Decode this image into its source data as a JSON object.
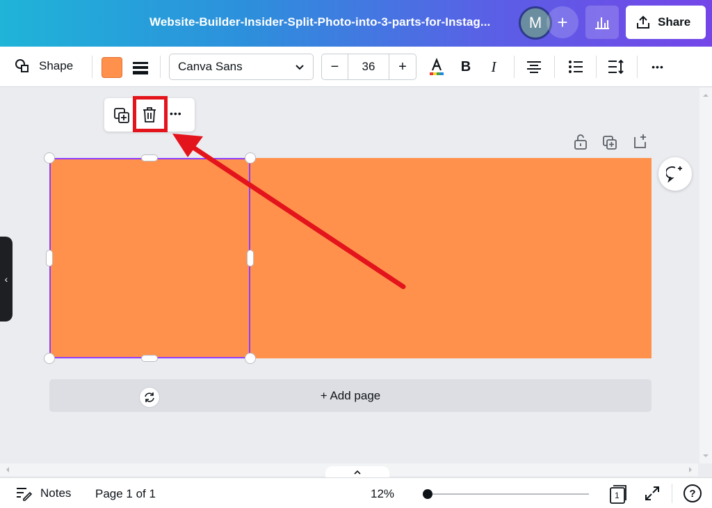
{
  "header": {
    "doc_title": "Website-Builder-Insider-Split-Photo-into-3-parts-for-Instag...",
    "avatar_initial": "M",
    "add_collab": "+",
    "share_label": "Share"
  },
  "toolbar": {
    "shape_label": "Shape",
    "fill_color": "#ff914d",
    "font_family": "Canva Sans",
    "size_minus": "−",
    "font_size": "36",
    "size_plus": "+",
    "bold": "B",
    "italic": "I",
    "more": "•••"
  },
  "selection_toolbar": {
    "more": "•••"
  },
  "canvas": {
    "add_page_label": "+ Add page",
    "page_color": "#ff914d",
    "selection_color": "#8b3dff",
    "highlight_color": "#e3141b"
  },
  "left_panel": {
    "toggle": "‹"
  },
  "footer": {
    "notes_label": "Notes",
    "page_count": "Page 1 of 1",
    "zoom": "12%",
    "page_grid_count": "1",
    "help": "?"
  },
  "icons": {
    "shape": "shape-icon",
    "duplicate": "duplicate-icon",
    "delete": "trash-icon",
    "lock": "lock-icon",
    "comment": "comment-icon"
  }
}
